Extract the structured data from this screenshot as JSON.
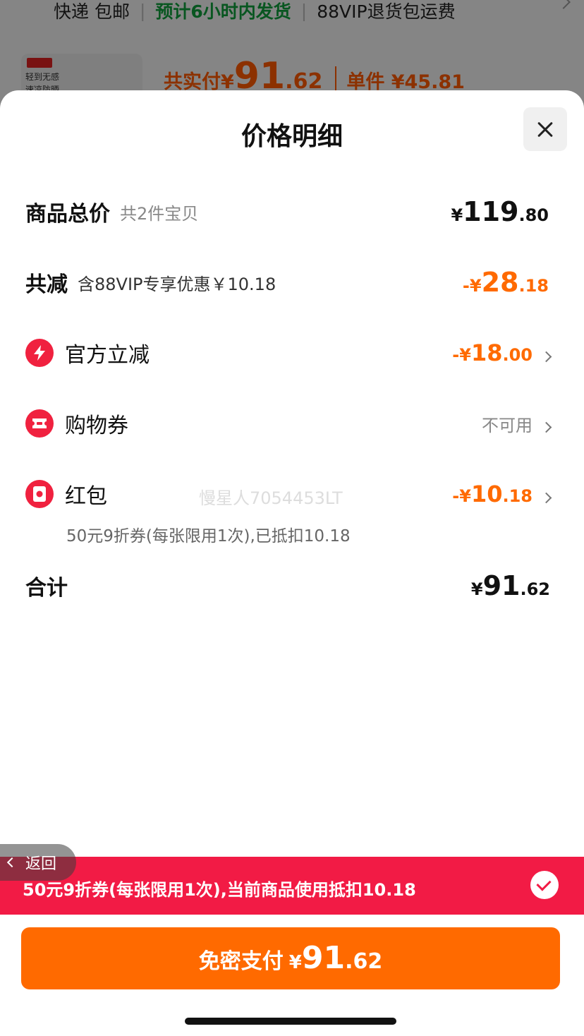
{
  "background": {
    "shipping": "快递 包邮",
    "dispatch": "预计6小时内发货",
    "return_fee": "88VIP退货包运费",
    "thumb_line1": "轻到无感",
    "thumb_line2": "速凉防晒",
    "total_label": "共实付",
    "total_currency": "¥",
    "total_int": "91",
    "total_dec": ".62",
    "unit_price": "单件 ¥45.81"
  },
  "sheet": {
    "title": "价格明细",
    "rows": {
      "goods": {
        "label": "商品总价",
        "sub": "共2件宝贝",
        "cur": "¥",
        "int": "119",
        "dec": ".80"
      },
      "discount": {
        "label": "共减",
        "sub": "含88VIP专享优惠￥10.18",
        "cur": "-¥",
        "int": "28",
        "dec": ".18"
      },
      "official": {
        "label": "官方立减",
        "cur": "-¥",
        "int": "18",
        "dec": ".00"
      },
      "coupon": {
        "label": "购物券",
        "status": "不可用"
      },
      "redpacket": {
        "label": "红包",
        "cur": "-¥",
        "int": "10",
        "dec": ".18",
        "note": "50元9折券(每张限用1次),已抵扣10.18"
      },
      "total": {
        "label": "合计",
        "cur": "¥",
        "int": "91",
        "dec": ".62"
      }
    },
    "watermark": "慢星人7054453LT"
  },
  "footer": {
    "back_label": "返回",
    "banner_text": "50元9折券(每张限用1次),当前商品使用抵扣10.18",
    "pay_label": "免密支付",
    "pay_cur": "¥",
    "pay_int": "91",
    "pay_dec": ".62"
  },
  "colors": {
    "accent": "#ff6a00",
    "red": "#f21b45",
    "icon_red": "#f0213f"
  }
}
